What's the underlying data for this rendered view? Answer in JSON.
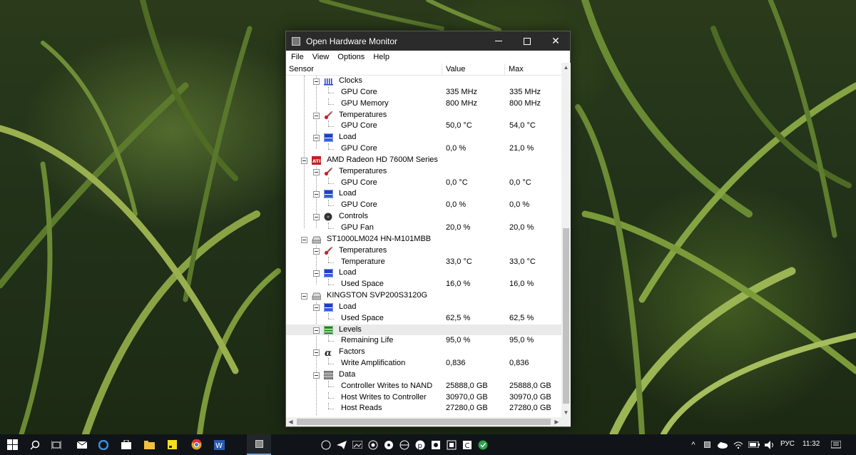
{
  "window": {
    "title": "Open Hardware Monitor",
    "minimize": "—",
    "maximize": "☐",
    "close": "✕"
  },
  "menu": [
    "File",
    "View",
    "Options",
    "Help"
  ],
  "columns": {
    "sensor": "Sensor",
    "value": "Value",
    "max": "Max"
  },
  "rows": [
    {
      "level": 2,
      "icon": "clock",
      "label": "Clocks",
      "value": "",
      "max": ""
    },
    {
      "level": 3,
      "icon": "",
      "label": "GPU Core",
      "value": "335 MHz",
      "max": "335 MHz"
    },
    {
      "level": 3,
      "icon": "",
      "label": "GPU Memory",
      "value": "800 MHz",
      "max": "800 MHz"
    },
    {
      "level": 2,
      "icon": "thermometer",
      "label": "Temperatures",
      "value": "",
      "max": ""
    },
    {
      "level": 3,
      "icon": "",
      "label": "GPU Core",
      "value": "50,0 °C",
      "max": "54,0 °C"
    },
    {
      "level": 2,
      "icon": "load",
      "label": "Load",
      "value": "",
      "max": ""
    },
    {
      "level": 3,
      "icon": "",
      "label": "GPU Core",
      "value": "0,0 %",
      "max": "21,0 %"
    },
    {
      "level": 1,
      "icon": "ati",
      "label": "AMD Radeon HD 7600M Series",
      "value": "",
      "max": ""
    },
    {
      "level": 2,
      "icon": "thermometer",
      "label": "Temperatures",
      "value": "",
      "max": ""
    },
    {
      "level": 3,
      "icon": "",
      "label": "GPU Core",
      "value": "0,0 °C",
      "max": "0,0 °C"
    },
    {
      "level": 2,
      "icon": "load",
      "label": "Load",
      "value": "",
      "max": ""
    },
    {
      "level": 3,
      "icon": "",
      "label": "GPU Core",
      "value": "0,0 %",
      "max": "0,0 %"
    },
    {
      "level": 2,
      "icon": "fan",
      "label": "Controls",
      "value": "",
      "max": ""
    },
    {
      "level": 3,
      "icon": "",
      "label": "GPU Fan",
      "value": "20,0 %",
      "max": "20,0 %"
    },
    {
      "level": 1,
      "icon": "hdd",
      "label": "ST1000LM024 HN-M101MBB",
      "value": "",
      "max": ""
    },
    {
      "level": 2,
      "icon": "thermometer",
      "label": "Temperatures",
      "value": "",
      "max": ""
    },
    {
      "level": 3,
      "icon": "",
      "label": "Temperature",
      "value": "33,0 °C",
      "max": "33,0 °C"
    },
    {
      "level": 2,
      "icon": "load",
      "label": "Load",
      "value": "",
      "max": ""
    },
    {
      "level": 3,
      "icon": "",
      "label": "Used Space",
      "value": "16,0 %",
      "max": "16,0 %"
    },
    {
      "level": 1,
      "icon": "hdd",
      "label": "KINGSTON SVP200S3120G",
      "value": "",
      "max": ""
    },
    {
      "level": 2,
      "icon": "load",
      "label": "Load",
      "value": "",
      "max": ""
    },
    {
      "level": 3,
      "icon": "",
      "label": "Used Space",
      "value": "62,5 %",
      "max": "62,5 %"
    },
    {
      "level": 2,
      "icon": "levels",
      "label": "Levels",
      "value": "",
      "max": "",
      "highlight": true
    },
    {
      "level": 3,
      "icon": "",
      "label": "Remaining Life",
      "value": "95,0 %",
      "max": "95,0 %"
    },
    {
      "level": 2,
      "icon": "factor",
      "label": "Factors",
      "value": "",
      "max": ""
    },
    {
      "level": 3,
      "icon": "",
      "label": "Write Amplification",
      "value": "0,836",
      "max": "0,836"
    },
    {
      "level": 2,
      "icon": "data",
      "label": "Data",
      "value": "",
      "max": ""
    },
    {
      "level": 3,
      "icon": "",
      "label": "Controller Writes to NAND",
      "value": "25888,0 GB",
      "max": "25888,0 GB"
    },
    {
      "level": 3,
      "icon": "",
      "label": "Host Writes to Controller",
      "value": "30970,0 GB",
      "max": "30970,0 GB"
    },
    {
      "level": 3,
      "icon": "",
      "label": "Host Reads",
      "value": "27280,0 GB",
      "max": "27280,0 GB"
    }
  ],
  "tray": {
    "language": "РУС",
    "time": "11:32"
  },
  "colors": {
    "titlebar": "#2b2b2b",
    "taskbar": "#101418",
    "load_icon": "#2040c0",
    "levels_icon": "#208020",
    "thermometer": "#d02020"
  }
}
